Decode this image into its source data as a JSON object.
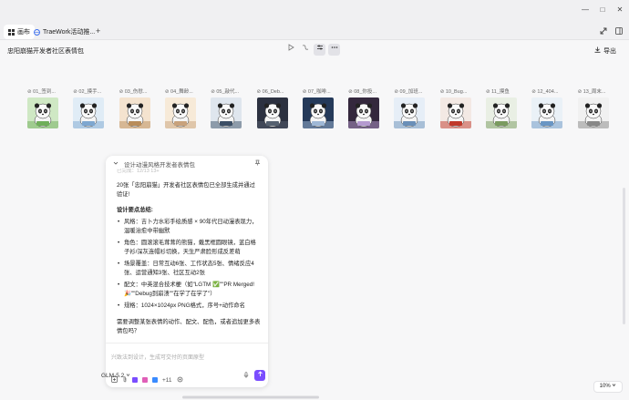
{
  "window": {
    "controls": [
      "—",
      "□",
      "✕"
    ]
  },
  "tabs": [
    {
      "label": "画布",
      "icon": "grid-icon"
    },
    {
      "label": "TraeWork活动推...",
      "icon": "globe-icon"
    }
  ],
  "tab_add": "+",
  "header": {
    "title": "忠阳崩猫开发者社区表情包",
    "export_label": "导出"
  },
  "thumbnails": [
    {
      "label": "01_签到..."
    },
    {
      "label": "02_摸手..."
    },
    {
      "label": "03_伤慰..."
    },
    {
      "label": "04_舞龄..."
    },
    {
      "label": "05_敲代..."
    },
    {
      "label": "06_Deb..."
    },
    {
      "label": "07_咖啡..."
    },
    {
      "label": "08_你投..."
    },
    {
      "label": "09_加班..."
    },
    {
      "label": "10_Bug..."
    },
    {
      "label": "11_摸鱼"
    },
    {
      "label": "12_404..."
    },
    {
      "label": "13_周末..."
    }
  ],
  "chat": {
    "header_title": "设计动漫风格开发者表情包",
    "faded_line": "已完成：12/13 13+",
    "intro": "20张「忠阳崩猫」开发者社区表情包已全部生成并通过验证!",
    "summary_title": "设计要点总结:",
    "bullets": [
      "风格：吉卜力水彩手绘质感 × 90年代日动漫表现力，温暖治愈中带幽默",
      "角色：圆滚滚毛茸茸的熊猫，戴黑框圆眼镜，蓝白格子衫/深灰连帽衫切换，天生严肃脸形成反差萌",
      "场景覆盖：日常互动6张、工作状态5张、情绪反应4张、运营通知3张、社区互动2张",
      "配文：中英混合技术梗（如\"LGTM ✅\"\"PR Merged! 🎉\"\"Debug到崩溃\"\"在学了在学了\"）",
      "规格：1024×1024px PNG格式，序号+动作命名"
    ],
    "question": "需要调整某张表情的动作、配文、配色，或者追加更多表情包吗？",
    "input_placeholder": "兴致法到设计，生成可交付的页面原型",
    "tool_count": "+11",
    "model": "GLM-5.2"
  },
  "zoom": "10%",
  "colors": {
    "accent": "#7a4dff",
    "background": "#f7f7f8"
  }
}
